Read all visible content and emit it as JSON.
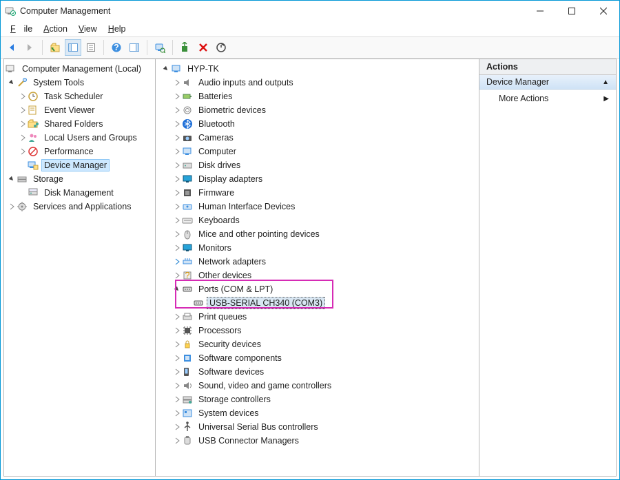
{
  "window": {
    "title": "Computer Management"
  },
  "menu": {
    "file": "File",
    "action": "Action",
    "view": "View",
    "help": "Help"
  },
  "leftTree": {
    "root": "Computer Management (Local)",
    "systools": "System Tools",
    "taskSched": "Task Scheduler",
    "eventViewer": "Event Viewer",
    "sharedFolders": "Shared Folders",
    "localUsers": "Local Users and Groups",
    "performance": "Performance",
    "deviceManager": "Device Manager",
    "storage": "Storage",
    "diskMgmt": "Disk Management",
    "services": "Services and Applications"
  },
  "midTree": {
    "root": "HYP-TK",
    "items": [
      "Audio inputs and outputs",
      "Batteries",
      "Biometric devices",
      "Bluetooth",
      "Cameras",
      "Computer",
      "Disk drives",
      "Display adapters",
      "Firmware",
      "Human Interface Devices",
      "Keyboards",
      "Mice and other pointing devices",
      "Monitors",
      "Network adapters",
      "Other devices",
      "Ports (COM & LPT)",
      "Print queues",
      "Processors",
      "Security devices",
      "Software components",
      "Software devices",
      "Sound, video and game controllers",
      "Storage controllers",
      "System devices",
      "Universal Serial Bus controllers",
      "USB Connector Managers"
    ],
    "portChild": "USB-SERIAL CH340 (COM3)"
  },
  "actions": {
    "header": "Actions",
    "section": "Device Manager",
    "more": "More Actions"
  }
}
